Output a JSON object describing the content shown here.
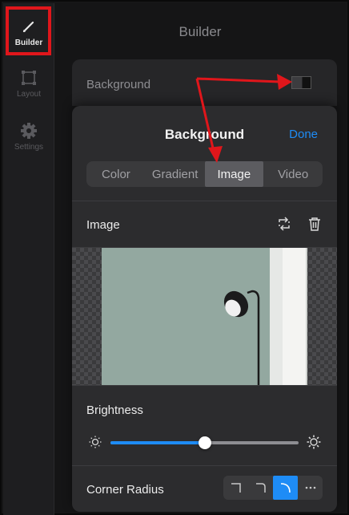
{
  "sidebar": {
    "items": [
      {
        "label": "Builder",
        "icon": "pencil-icon",
        "active": true
      },
      {
        "label": "Layout",
        "icon": "layout-icon",
        "active": false
      },
      {
        "label": "Settings",
        "icon": "gear-icon",
        "active": false
      }
    ]
  },
  "main": {
    "title": "Builder",
    "background_row": {
      "label": "Background"
    }
  },
  "popover": {
    "title": "Background",
    "done_label": "Done",
    "tabs": [
      {
        "label": "Color"
      },
      {
        "label": "Gradient"
      },
      {
        "label": "Image"
      },
      {
        "label": "Video"
      }
    ],
    "active_tab": "Image",
    "image_section": {
      "label": "Image",
      "replace_icon": "replace-icon",
      "delete_icon": "trash-icon"
    },
    "brightness": {
      "label": "Brightness",
      "value": 0.5
    },
    "corner_radius": {
      "label": "Corner Radius",
      "options": [
        "square-corner-icon",
        "rounded-corner-icon",
        "round-corner-icon",
        "more-icon"
      ],
      "selected_index": 2
    }
  },
  "colors": {
    "accent": "#1e8cf6",
    "annotation": "#e0161b"
  }
}
